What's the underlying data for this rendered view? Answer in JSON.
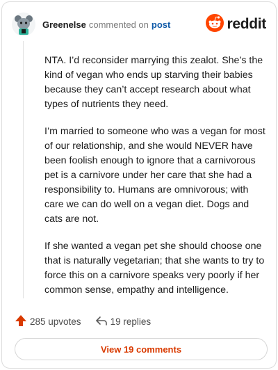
{
  "comment": {
    "author": "Greenelse",
    "verb": "commented on",
    "post_link": "post",
    "brand": "reddit",
    "paragraphs": [
      "NTA. I’d reconsider marrying this zealot. She’s the kind of vegan who ends up starving their babies because they can’t accept research about what types of nutrients they need.",
      "I’m married to someone who was a vegan for most of our relationship, and she would NEVER have been foolish enough to ignore that a carnivorous pet is a carnivore under her care that she had a responsibility to. Humans are omnivorous; with care we can do well on a vegan diet. Dogs and cats are not.",
      "If she wanted a vegan pet she should choose one that is naturally vegetarian; that she wants to try to force this on a carnivore speaks very poorly if her common sense, empathy and intelligence."
    ],
    "upvotes_label": "285 upvotes",
    "replies_label": "19 replies",
    "view_comments_label": "View 19 comments"
  },
  "icons": {
    "avatar": "snoo-avatar-icon",
    "brand": "reddit-logo-icon",
    "upvote": "upvote-arrow-icon",
    "reply": "reply-arrow-icon"
  },
  "colors": {
    "accent": "#d93a00",
    "brand": "#ff4500",
    "link": "#0f5aa8",
    "muted": "#7c7c7c"
  }
}
